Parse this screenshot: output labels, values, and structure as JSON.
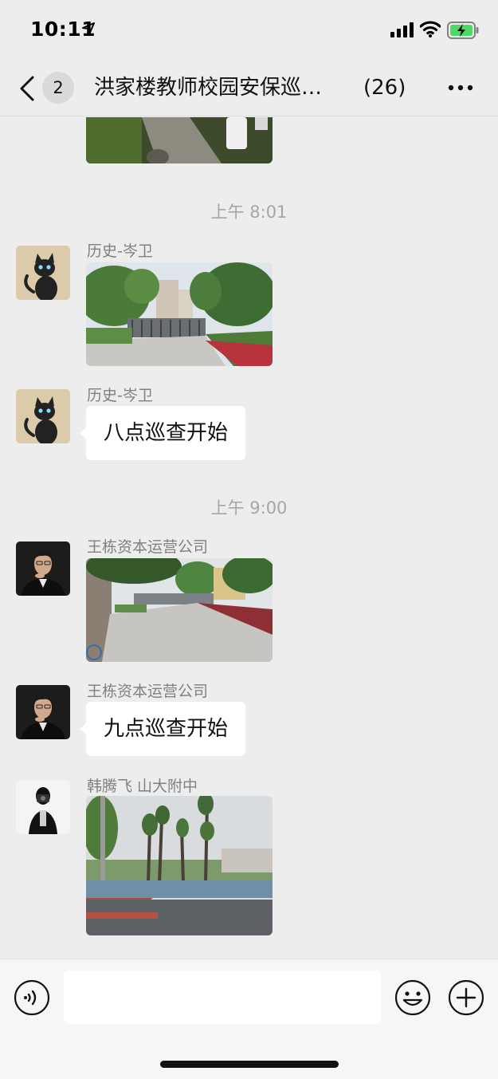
{
  "status_bar": {
    "time": "10:11",
    "icons": [
      "location-arrow-icon",
      "cellular-signal-icon",
      "wifi-icon",
      "battery-charging-icon"
    ]
  },
  "nav": {
    "back_icon": "chevron-left-icon",
    "unread_count": "2",
    "title": "洪家楼教师校园安保巡…",
    "member_count": "(26)",
    "more_icon": "ellipsis-icon"
  },
  "messages": [
    {
      "type": "time",
      "text": "上午 8:01"
    },
    {
      "type": "image",
      "sender": "历史-岑卫",
      "avatar": "black-cat-avatar",
      "image": "campus-gate-photo"
    },
    {
      "type": "text",
      "sender": "历史-岑卫",
      "avatar": "black-cat-avatar",
      "text": "八点巡查开始"
    },
    {
      "type": "time",
      "text": "上午 9:00"
    },
    {
      "type": "image",
      "sender": "王栋资本运营公司",
      "avatar": "man-portrait-avatar",
      "image": "campus-road-photo"
    },
    {
      "type": "text",
      "sender": "王栋资本运营公司",
      "avatar": "man-portrait-avatar",
      "text": "九点巡查开始"
    },
    {
      "type": "image",
      "sender": "韩腾飞 山大附中",
      "avatar": "camera-photographer-avatar",
      "image": "sports-court-trees-photo"
    }
  ],
  "input_bar": {
    "voice_icon": "voice-input-icon",
    "input_value": "",
    "emoji_icon": "emoji-smile-icon",
    "plus_icon": "plus-circle-icon"
  },
  "colors": {
    "background": "#ededed",
    "bubble": "#ffffff",
    "battery_fill": "#4cd964",
    "timestamp": "#a6a6a6"
  }
}
